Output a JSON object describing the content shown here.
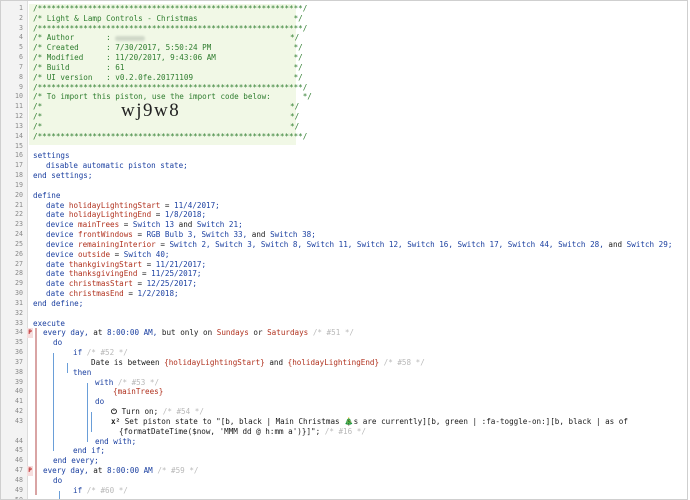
{
  "line_numbers": [
    "1",
    "2",
    "3",
    "4",
    "5",
    "6",
    "7",
    "8",
    "9",
    "10",
    "11",
    "12",
    "13",
    "14",
    "15",
    "16",
    "17",
    "18",
    "19",
    "20",
    "21",
    "22",
    "23",
    "24",
    "25",
    "26",
    "27",
    "28",
    "29",
    "30",
    "31",
    "32",
    "33",
    "34",
    "35",
    "36",
    "37",
    "38",
    "39",
    "40",
    "41",
    "42",
    "43",
    "",
    "44",
    "45",
    "46",
    "47",
    "48",
    "49",
    "50"
  ],
  "header": {
    "rule": "/**********************************************************/",
    "title": "/* Light & Lamp Controls - Christmas                     */",
    "author_label": "/* Author       : ",
    "author_end": "*/",
    "created": "/* Created      : 7/30/2017, 5:50:24 PM                  */",
    "modified": "/* Modified     : 11/20/2017, 9:43:06 AM                 */",
    "build": "/* Build        : 61                                     */",
    "ui_version": "/* UI version   : v0.2.0fe.20171109                      */",
    "import_note": "/* To import this piston, use the import code below:       */",
    "blank_start": "/*",
    "blank_end": "*/",
    "import_code": "wj9w8"
  },
  "settings": {
    "open": "settings",
    "body": "disable automatic piston state;",
    "close": "end settings;"
  },
  "define": {
    "open": "define",
    "close": "end define;",
    "holiday_start": {
      "type": "date",
      "name": "holidayLightingStart",
      "value": "11/4/2017;"
    },
    "holiday_end": {
      "type": "date",
      "name": "holidayLightingEnd",
      "value": "1/8/2018;"
    },
    "main_trees": {
      "type": "device",
      "name": "mainTrees",
      "value": "Switch 13",
      "and": "and",
      "value2": "Switch 21;"
    },
    "front_windows": {
      "type": "device",
      "name": "frontWindows",
      "v1": "RGB Bulb 3,",
      "v2": "Switch 33,",
      "and": "and",
      "v3": "Switch 38;"
    },
    "remaining_interior": {
      "type": "device",
      "name": "remainingInterior",
      "devices": "Switch 2, Switch 3, Switch 8, Switch 11, Switch 12, Switch 16, Switch 17, Switch 44, Switch 28,",
      "and": "and",
      "last": "Switch 29;"
    },
    "outside": {
      "type": "device",
      "name": "outside",
      "value": "Switch 40;"
    },
    "thanksgiving_start": {
      "type": "date",
      "name": "thankgivingStart",
      "value": "11/21/2017;"
    },
    "thanksgiving_end": {
      "type": "date",
      "name": "thanksgivingEnd",
      "value": "11/25/2017;"
    },
    "christmas_start": {
      "type": "date",
      "name": "christmasStart",
      "value": "12/25/2017;"
    },
    "christmas_end": {
      "type": "date",
      "name": "christmasEnd",
      "value": "1/2/2018;"
    }
  },
  "execute": {
    "open": "execute",
    "every1": {
      "every": "every day,",
      "at": "at",
      "time": "8:00:00 AM,",
      "but": "but only on",
      "d1": "Sundays",
      "or": "or",
      "d2": "Saturdays",
      "tag": "/* #51 */"
    },
    "do": "do",
    "if": "if",
    "if_tag": "/* #52 */",
    "cond": {
      "lead": "Date is between",
      "a": "{holidayLightingStart}",
      "and": "and",
      "b": "{holidayLightingEnd}",
      "tag": "/* #58 */"
    },
    "then": "then",
    "with": "with",
    "with_tag": "/* #53 */",
    "with_target": "{mainTrees}",
    "turn_on": "Turn on;",
    "turn_on_tag": "/* #54 */",
    "set_state": "Set piston state to \"[b, black | Main Christmas ",
    "set_state_tree": "🎄",
    "set_state_b": "s are currently][b, green | :fa-toggle-on:][b, black | as of",
    "set_state_c": "{formatDateTime($now, 'MMM dd @ h:mm a')}]\";",
    "set_state_tag": "/* #16 */",
    "end_with": "end with;",
    "end_if": "end if;",
    "end_every": "end every;",
    "every2": {
      "every": "every day,",
      "at": "at",
      "time": "8:00:00 AM",
      "tag": "/* #59 */"
    },
    "if2_tag": "/* #60 */",
    "flag": "P"
  }
}
